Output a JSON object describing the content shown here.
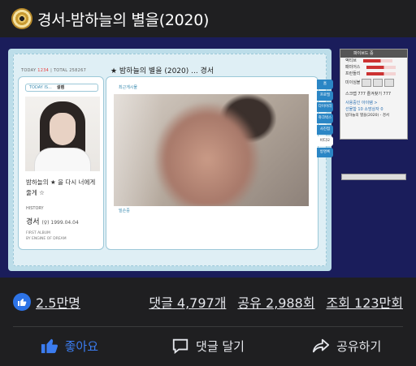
{
  "header": {
    "title": "경서-밤하늘의 별을(2020)",
    "icon": "gold-disc-icon"
  },
  "cyworld": {
    "counter": {
      "today_label": "TODAY",
      "today": "1234",
      "total_label": "TOTAL",
      "total": "258267"
    },
    "today_bar": {
      "label": "TODAY IS...",
      "mood": "설렘"
    },
    "bio": "밤하늘의 ★ 을 다시 너에게 줄게 ☆",
    "history_label": "HISTORY",
    "artist": "경서",
    "artist_sub": "(♀) 1999.04.04",
    "album_lines": [
      "FIRST ALBUM",
      "BY ENGINE OF DREAM"
    ],
    "page_title": "★ 밤하늘의 별을 (2020) ... 경서",
    "section_label": "최근게시물",
    "photo_caption": "밀손중",
    "tabs": [
      "홈",
      "프로필",
      "다이어리",
      "쥬크박스",
      "사진첩",
      "비디오",
      "방명록"
    ],
    "active_tab": "비디오",
    "side": {
      "header": "파이브드 중",
      "rows": [
        "액티브",
        "패미어스",
        "프런들리"
      ],
      "icons_label": "미이심볼",
      "scrap": "스크랩 777  즐겨찾기 777",
      "link1": "사용중인 아이템 >",
      "link2": "선물함 10  소망상자 0",
      "now_playing": "밤하늘의 별을(2020) - 경서"
    }
  },
  "stats": {
    "likes": "2.5만명",
    "comments": "댓글 4,797개",
    "shares": "공유 2,988회",
    "views": "조회 123만회"
  },
  "actions": {
    "like": "좋아요",
    "comment": "댓글 달기",
    "share": "공유하기"
  },
  "colors": {
    "background": "#1f1f21",
    "video_bg": "#1a1d5b",
    "accent": "#2d73e6",
    "frame": "#bcdde9"
  }
}
